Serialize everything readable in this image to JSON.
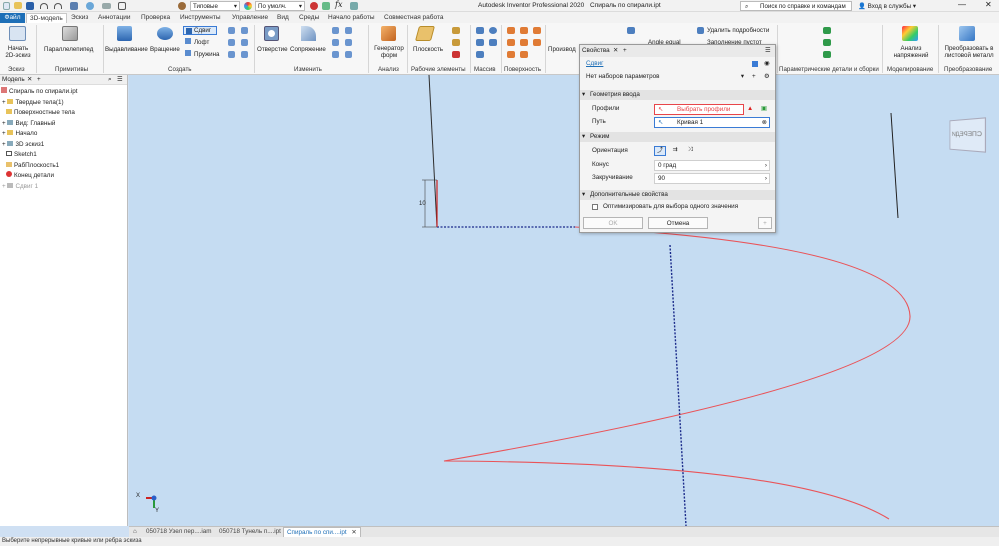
{
  "title_bar": {
    "style_value": "Типовые",
    "material_value": "По умолч.",
    "app_title": "Autodesk Inventor Professional 2020",
    "doc_title": "Спираль по спирали.ipt",
    "search_placeholder": "Поиск по справке и командам",
    "signin_label": "Вход в службы"
  },
  "ribbon_tabs": [
    "Файл",
    "3D-модель",
    "Эскиз",
    "Аннотации",
    "Проверка",
    "Инструменты",
    "Управление",
    "Вид",
    "Среды",
    "Начало работы",
    "Совместная работа"
  ],
  "ribbon": {
    "sketch": {
      "start_label": "Начать 2D-эскиз",
      "group_label": "Эскиз"
    },
    "primitives": {
      "box_label": "Параллелепипед",
      "group_label": "Примитивы"
    },
    "create": {
      "extrude_label": "Выдавливание",
      "revolve_label": "Вращение",
      "sweep_label": "Сдвиг",
      "loft_label": "Лофт",
      "coil_label": "Пружина",
      "group_label": "Создать"
    },
    "modify": {
      "hole_label": "Отверстие",
      "fillet_label": "Сопряжение",
      "group_label": "Изменить"
    },
    "explore": {
      "generator_label": "Генератор форм",
      "group_label": "Анализ"
    },
    "work": {
      "plane_label": "Плоскость",
      "group_label": "Рабочие элементы"
    },
    "pattern": {
      "group_label": "Массив"
    },
    "surface": {
      "group_label": "Поверхность"
    },
    "derived": {
      "label": "Производ"
    },
    "convert": {
      "angle_label": "Angle equal",
      "remove_detail_label": "Удалить подробности",
      "fill_label": "Заполнение пустот"
    },
    "params_group_label": "Параметрические детали и сборки",
    "simulation": {
      "stress_label": "Анализ напряжений",
      "group_label": "Моделирование"
    },
    "convert_sm": {
      "label": "Преобразовать в листовой металл",
      "group_label": "Преобразование"
    }
  },
  "browser": {
    "tab_label": "Модель",
    "items": [
      "Спираль по спирали.ipt",
      "Твердые тела(1)",
      "Поверхностные тела",
      "Вид: Главный",
      "Начало",
      "3D эскиз1",
      "Sketch1",
      "РабПлоскость1",
      "Конец детали",
      "Сдвиг 1"
    ]
  },
  "sweep_panel": {
    "tab_label": "Свойства",
    "feature_label": "Сдвиг",
    "preset_value": "Нет наборов параметров",
    "sections": {
      "input": "Геометрия ввода",
      "mode": "Режим",
      "advanced": "Дополнительные свойства"
    },
    "profiles_label": "Профили",
    "profiles_value": "Выбрать профили",
    "path_label": "Путь",
    "path_value": "Кривая 1",
    "orientation_label": "Ориентация",
    "taper_label": "Конус",
    "taper_value": "0 град",
    "twist_label": "Закручивание",
    "twist_value": "90",
    "optimize_label": "Оптимизировать для выбора одного значения",
    "ok_label": "OK",
    "cancel_label": "Отмена"
  },
  "viewport": {
    "dimension_value": "10",
    "viewcube_label": "СПЕРЕДИ",
    "axis_x": "X",
    "axis_y": "Y"
  },
  "doc_tabs": [
    "050718 Узел пер....iam",
    "050718 Тунель п....ipt",
    "Спираль по спи....ipt"
  ],
  "status_text": "Выберите непрерывные кривые или ребра эскиза",
  "colors": {
    "accent": "#1e6fb7",
    "profile_red": "#e8454a",
    "helix_red": "#ea5358",
    "path_blue": "#1a2a8a",
    "viewport_bg": "#c5dcf2"
  }
}
